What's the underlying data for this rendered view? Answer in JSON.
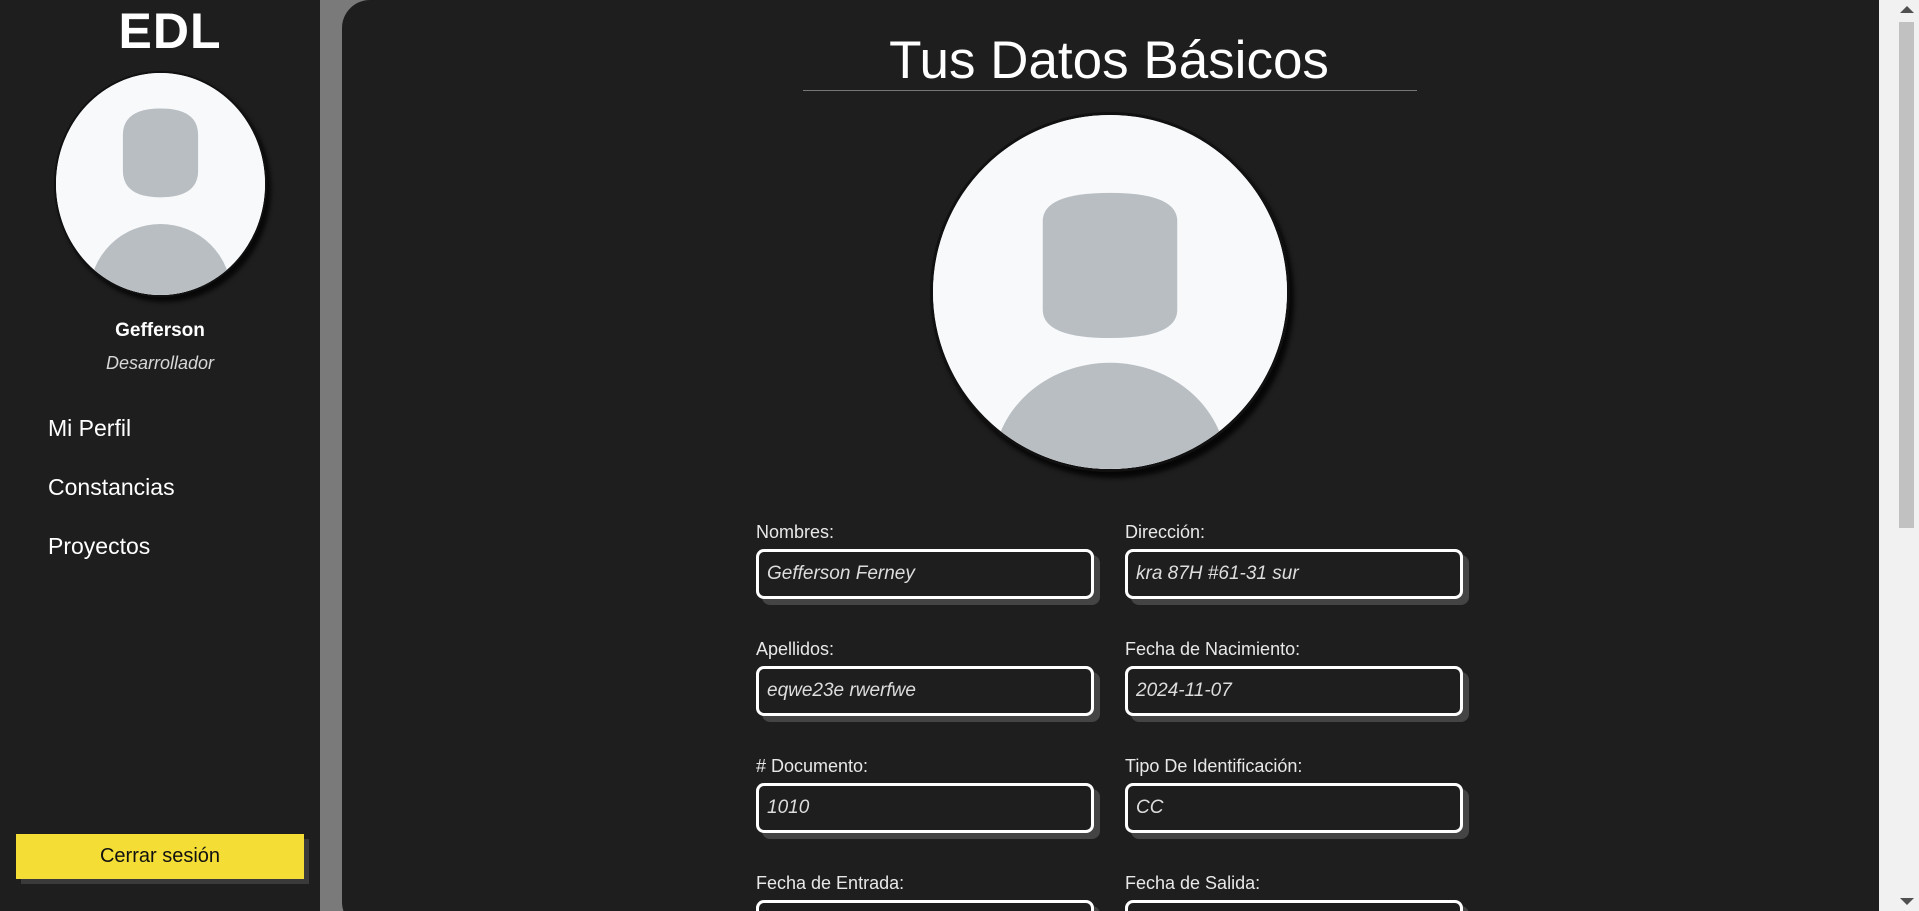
{
  "sidebar": {
    "brand": "EDL",
    "user_name": "Gefferson",
    "user_role": "Desarrollador",
    "nav": [
      {
        "label": "Mi Perfil"
      },
      {
        "label": "Constancias"
      },
      {
        "label": "Proyectos"
      }
    ],
    "logout_label": "Cerrar sesión"
  },
  "main": {
    "title": "Tus Datos Básicos",
    "fields": {
      "nombres": {
        "label": "Nombres:",
        "value": "Gefferson Ferney"
      },
      "direccion": {
        "label": "Dirección:",
        "value": "kra 87H #61-31 sur"
      },
      "apellidos": {
        "label": "Apellidos:",
        "value": "eqwe23e rwerfwe"
      },
      "fecha_nacimiento": {
        "label": "Fecha de Nacimiento:",
        "value": "2024-11-07"
      },
      "documento": {
        "label": "# Documento:",
        "value": "1010"
      },
      "tipo_identificacion": {
        "label": "Tipo De Identificación:",
        "value": "CC"
      },
      "fecha_entrada": {
        "label": "Fecha de Entrada:",
        "value": ""
      },
      "fecha_salida": {
        "label": "Fecha de Salida:",
        "value": ""
      }
    }
  },
  "colors": {
    "panel": "#1e1e1e",
    "backdrop": "#7a7a7a",
    "accent": "#f4dd34",
    "avatar_bg": "#f8f9fa",
    "avatar_silhouette": "#b9bec3"
  },
  "icons": {
    "sidebar_avatar": "default-user-avatar-icon",
    "main_avatar": "default-user-avatar-icon"
  }
}
